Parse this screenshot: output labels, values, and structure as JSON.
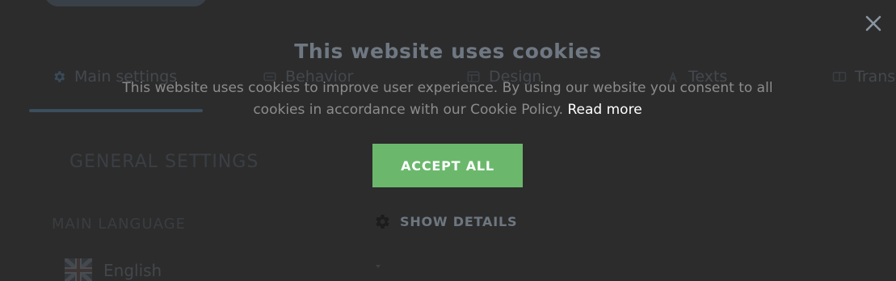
{
  "background": {
    "tabs": [
      {
        "label": "Main settings",
        "icon": "gear-icon"
      },
      {
        "label": "Behavior",
        "icon": "behavior-icon"
      },
      {
        "label": "Design",
        "icon": "design-icon"
      },
      {
        "label": "Texts",
        "icon": "text-icon"
      },
      {
        "label": "Translations",
        "icon": "translate-icon"
      }
    ],
    "section_title": "GENERAL SETTINGS",
    "language_label": "MAIN LANGUAGE",
    "language_value": "English",
    "language_flag": "uk-flag-icon"
  },
  "cookie_dialog": {
    "title": "This website uses cookies",
    "message": "This website uses cookies to improve user experience. By using our website you consent to all cookies in accordance with our Cookie Policy.",
    "read_more": "Read more",
    "accept_label": "ACCEPT ALL",
    "details_label": "SHOW DETAILS",
    "close_icon": "close-icon",
    "details_icon": "gear-icon"
  },
  "colors": {
    "backdrop": "#2c2c2c",
    "accept_button": "#6bb86c",
    "title": "#6f7882",
    "body_text": "#8c8c8c",
    "link": "#ffffff",
    "close_icon": "#8a95a0"
  }
}
